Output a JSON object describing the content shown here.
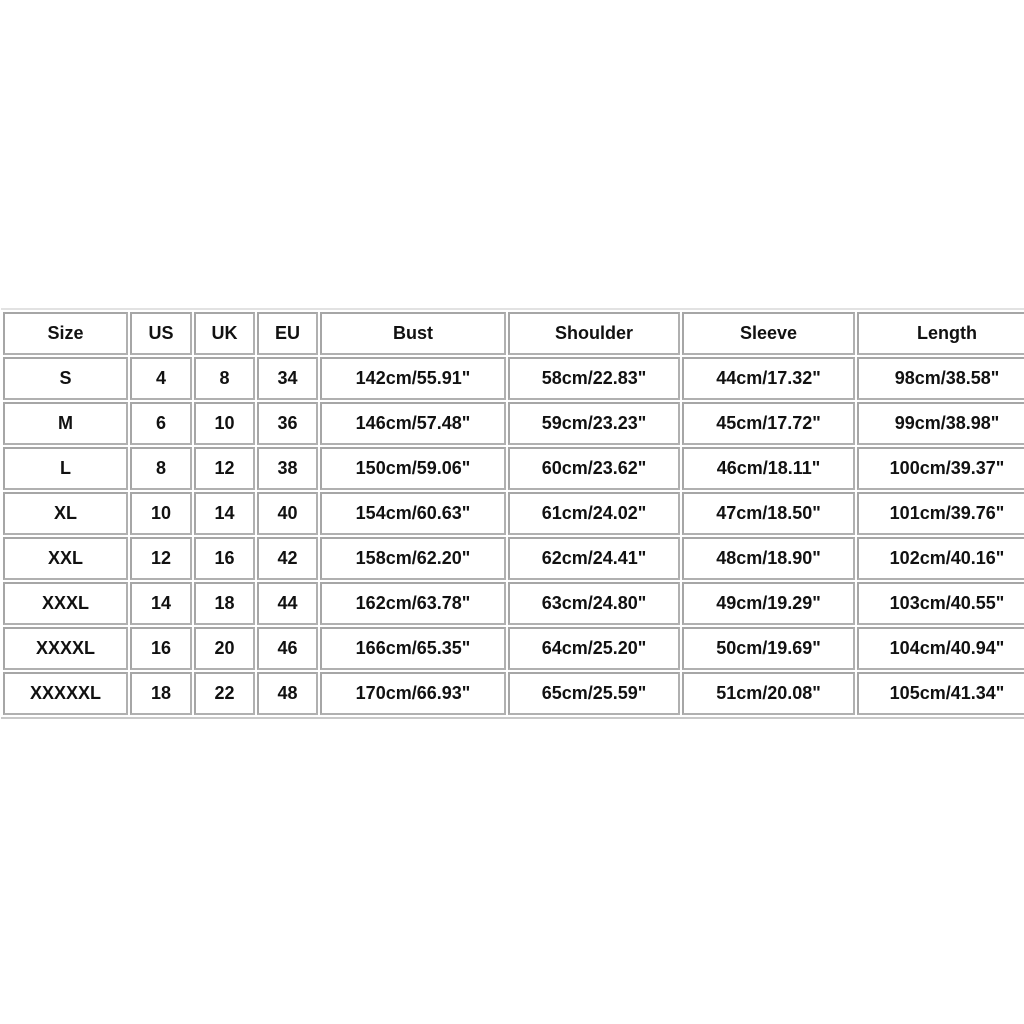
{
  "table": {
    "headers": [
      "Size",
      "US",
      "UK",
      "EU",
      "Bust",
      "Shoulder",
      "Sleeve",
      "Length"
    ],
    "rows": [
      [
        "S",
        "4",
        "8",
        "34",
        "142cm/55.91\"",
        "58cm/22.83\"",
        "44cm/17.32\"",
        "98cm/38.58\""
      ],
      [
        "M",
        "6",
        "10",
        "36",
        "146cm/57.48\"",
        "59cm/23.23\"",
        "45cm/17.72\"",
        "99cm/38.98\""
      ],
      [
        "L",
        "8",
        "12",
        "38",
        "150cm/59.06\"",
        "60cm/23.62\"",
        "46cm/18.11\"",
        "100cm/39.37\""
      ],
      [
        "XL",
        "10",
        "14",
        "40",
        "154cm/60.63\"",
        "61cm/24.02\"",
        "47cm/18.50\"",
        "101cm/39.76\""
      ],
      [
        "XXL",
        "12",
        "16",
        "42",
        "158cm/62.20\"",
        "62cm/24.41\"",
        "48cm/18.90\"",
        "102cm/40.16\""
      ],
      [
        "XXXL",
        "14",
        "18",
        "44",
        "162cm/63.78\"",
        "63cm/24.80\"",
        "49cm/19.29\"",
        "103cm/40.55\""
      ],
      [
        "XXXXL",
        "16",
        "20",
        "46",
        "166cm/65.35\"",
        "64cm/25.20\"",
        "50cm/19.69\"",
        "104cm/40.94\""
      ],
      [
        "XXXXXL",
        "18",
        "22",
        "48",
        "170cm/66.93\"",
        "65cm/25.59\"",
        "51cm/20.08\"",
        "105cm/41.34\""
      ]
    ]
  }
}
